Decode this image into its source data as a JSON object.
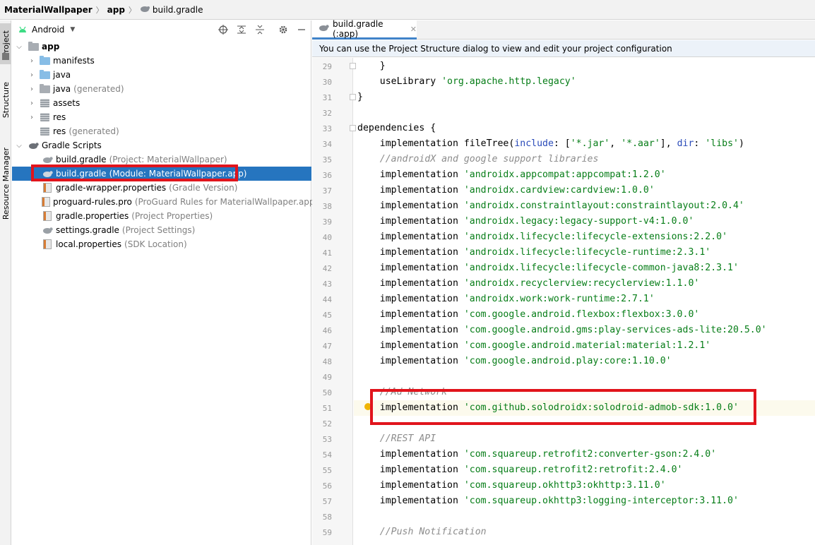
{
  "breadcrumb": {
    "items": [
      "MaterialWallpaper",
      "app",
      "build.gradle"
    ],
    "separator": "〉"
  },
  "left_strip": {
    "tabs": [
      "Project",
      "Structure",
      "Resource Manager"
    ]
  },
  "project_panel": {
    "view_selector": "Android",
    "toolbar_icons": [
      "locate-icon",
      "expand-all-icon",
      "collapse-all-icon",
      "settings-icon",
      "hide-icon"
    ],
    "tree": [
      {
        "name": "app",
        "hint": "",
        "type": "module",
        "expanded": true
      },
      {
        "name": "manifests",
        "hint": "",
        "type": "folder-blue"
      },
      {
        "name": "java",
        "hint": "",
        "type": "folder-blue"
      },
      {
        "name": "java",
        "hint": "(generated)",
        "type": "folder-gen"
      },
      {
        "name": "assets",
        "hint": "",
        "type": "folder-res"
      },
      {
        "name": "res",
        "hint": "",
        "type": "folder-res"
      },
      {
        "name": "res",
        "hint": "(generated)",
        "type": "folder-res"
      },
      {
        "name": "Gradle Scripts",
        "hint": "",
        "type": "gradle",
        "expanded": true
      },
      {
        "name": "build.gradle",
        "hint": "(Project: MaterialWallpaper)",
        "type": "gradle"
      },
      {
        "name": "build.gradle",
        "hint": "(Module: MaterialWallpaper.app)",
        "type": "gradle",
        "selected": true
      },
      {
        "name": "gradle-wrapper.properties",
        "hint": "(Gradle Version)",
        "type": "props"
      },
      {
        "name": "proguard-rules.pro",
        "hint": "(ProGuard Rules for MaterialWallpaper.app)",
        "type": "props"
      },
      {
        "name": "gradle.properties",
        "hint": "(Project Properties)",
        "type": "props"
      },
      {
        "name": "settings.gradle",
        "hint": "(Project Settings)",
        "type": "gradle"
      },
      {
        "name": "local.properties",
        "hint": "(SDK Location)",
        "type": "props"
      }
    ]
  },
  "editor": {
    "tab_label": "build.gradle (:app)",
    "notification": "You can use the Project Structure dialog to view and edit your project configuration",
    "lines": [
      {
        "n": "29",
        "segs": [
          [
            "    }",
            ""
          ]
        ]
      },
      {
        "n": "30",
        "segs": [
          [
            "    useLibrary ",
            ""
          ],
          [
            "'org.apache.http.legacy'",
            "str"
          ]
        ]
      },
      {
        "n": "31",
        "segs": [
          [
            "}",
            ""
          ]
        ]
      },
      {
        "n": "32",
        "segs": []
      },
      {
        "n": "33",
        "segs": [
          [
            "dependencies {",
            ""
          ]
        ]
      },
      {
        "n": "34",
        "segs": [
          [
            "    implementation fileTree(",
            ""
          ],
          [
            "include",
            "named"
          ],
          [
            ": [",
            ""
          ],
          [
            "'*.jar'",
            "str"
          ],
          [
            ", ",
            ""
          ],
          [
            "'*.aar'",
            "str"
          ],
          [
            "], ",
            ""
          ],
          [
            "dir",
            "named"
          ],
          [
            ": ",
            ""
          ],
          [
            "'libs'",
            "str"
          ],
          [
            ")",
            ""
          ]
        ]
      },
      {
        "n": "35",
        "segs": [
          [
            "    //androidX and google support libraries",
            "cmt"
          ]
        ]
      },
      {
        "n": "36",
        "segs": [
          [
            "    implementation ",
            ""
          ],
          [
            "'androidx.appcompat:appcompat:1.2.0'",
            "str"
          ]
        ]
      },
      {
        "n": "37",
        "segs": [
          [
            "    implementation ",
            ""
          ],
          [
            "'androidx.cardview:cardview:1.0.0'",
            "str"
          ]
        ]
      },
      {
        "n": "38",
        "segs": [
          [
            "    implementation ",
            ""
          ],
          [
            "'androidx.constraintlayout:constraintlayout:2.0.4'",
            "str"
          ]
        ]
      },
      {
        "n": "39",
        "segs": [
          [
            "    implementation ",
            ""
          ],
          [
            "'androidx.legacy:legacy-support-v4:1.0.0'",
            "str"
          ]
        ]
      },
      {
        "n": "40",
        "segs": [
          [
            "    implementation ",
            ""
          ],
          [
            "'androidx.lifecycle:lifecycle-extensions:2.2.0'",
            "str"
          ]
        ]
      },
      {
        "n": "41",
        "segs": [
          [
            "    implementation ",
            ""
          ],
          [
            "'androidx.lifecycle:lifecycle-runtime:2.3.1'",
            "str"
          ]
        ]
      },
      {
        "n": "42",
        "segs": [
          [
            "    implementation ",
            ""
          ],
          [
            "'androidx.lifecycle:lifecycle-common-java8:2.3.1'",
            "str"
          ]
        ]
      },
      {
        "n": "43",
        "segs": [
          [
            "    implementation ",
            ""
          ],
          [
            "'androidx.recyclerview:recyclerview:1.1.0'",
            "str"
          ]
        ]
      },
      {
        "n": "44",
        "segs": [
          [
            "    implementation ",
            ""
          ],
          [
            "'androidx.work:work-runtime:2.7.1'",
            "str"
          ]
        ]
      },
      {
        "n": "45",
        "segs": [
          [
            "    implementation ",
            ""
          ],
          [
            "'com.google.android.flexbox:flexbox:3.0.0'",
            "str"
          ]
        ]
      },
      {
        "n": "46",
        "segs": [
          [
            "    implementation ",
            ""
          ],
          [
            "'com.google.android.gms:play-services-ads-lite:20.5.0'",
            "str"
          ]
        ]
      },
      {
        "n": "47",
        "segs": [
          [
            "    implementation ",
            ""
          ],
          [
            "'com.google.android.material:material:1.2.1'",
            "str"
          ]
        ]
      },
      {
        "n": "48",
        "segs": [
          [
            "    implementation ",
            ""
          ],
          [
            "'com.google.android.play:core:1.10.0'",
            "str"
          ]
        ]
      },
      {
        "n": "49",
        "segs": []
      },
      {
        "n": "50",
        "segs": [
          [
            "    //Ad Network",
            "cmt"
          ]
        ]
      },
      {
        "n": "51",
        "segs": [
          [
            "    implementation ",
            ""
          ],
          [
            "'com.github.solodroidx:solodroid-admob-sdk:1.0.0'",
            "str"
          ]
        ]
      },
      {
        "n": "52",
        "segs": []
      },
      {
        "n": "53",
        "segs": [
          [
            "    //REST API",
            "cmt"
          ]
        ]
      },
      {
        "n": "54",
        "segs": [
          [
            "    implementation ",
            ""
          ],
          [
            "'com.squareup.retrofit2:converter-gson:2.4.0'",
            "str"
          ]
        ]
      },
      {
        "n": "55",
        "segs": [
          [
            "    implementation ",
            ""
          ],
          [
            "'com.squareup.retrofit2:retrofit:2.4.0'",
            "str"
          ]
        ]
      },
      {
        "n": "56",
        "segs": [
          [
            "    implementation ",
            ""
          ],
          [
            "'com.squareup.okhttp3:okhttp:3.11.0'",
            "str"
          ]
        ]
      },
      {
        "n": "57",
        "segs": [
          [
            "    implementation ",
            ""
          ],
          [
            "'com.squareup.okhttp3:logging-interceptor:3.11.0'",
            "str"
          ]
        ]
      },
      {
        "n": "58",
        "segs": []
      },
      {
        "n": "59",
        "segs": [
          [
            "    //Push Notification",
            "cmt"
          ]
        ]
      }
    ]
  },
  "colors": {
    "selection": "#2675bf",
    "highlight_box": "#e1141c",
    "string": "#067d17",
    "comment": "#8c8c8c"
  }
}
